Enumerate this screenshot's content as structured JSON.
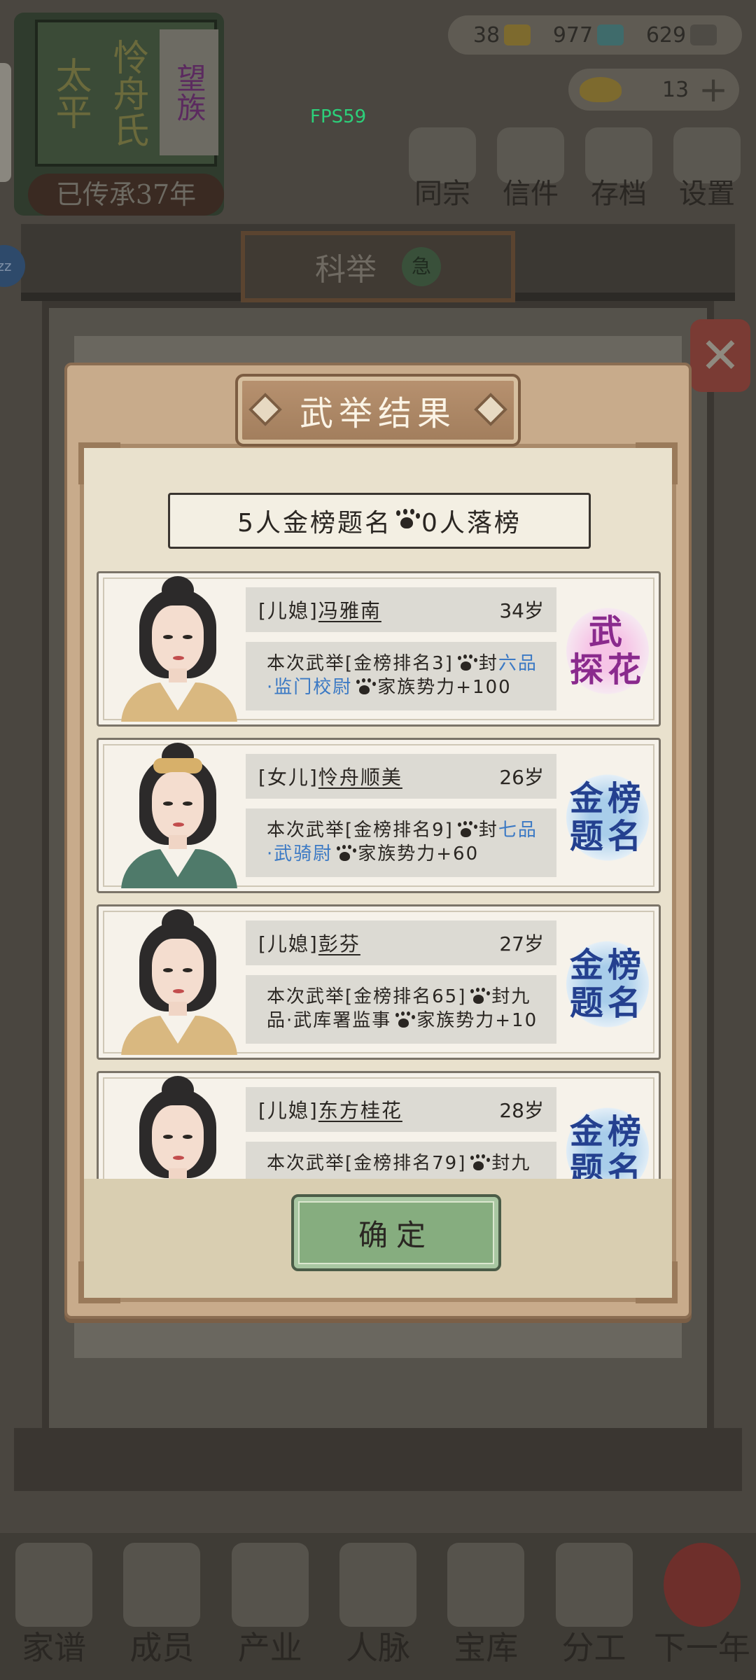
{
  "header": {
    "family_plaque": [
      "太平",
      "怜舟氏"
    ],
    "family_side": "望族",
    "inherit_text": "已传承37年",
    "fps": "FPS59",
    "currencies": [
      {
        "icon": "gold-coin-icon",
        "value": "38",
        "color": "#7d6a2e"
      },
      {
        "icon": "silver-bill-icon",
        "value": "977",
        "color": "#3f6b6b"
      },
      {
        "icon": "copper-coin-icon",
        "value": "629",
        "color": "#4e4b45"
      }
    ],
    "gold_ingot": "13",
    "top_menu": [
      "同宗",
      "信件",
      "存档",
      "设置"
    ]
  },
  "hall": {
    "title": "科举",
    "badge": "急",
    "zz_badge": "zz"
  },
  "bottom_nav": [
    "家谱",
    "成员",
    "产业",
    "人脉",
    "宝库",
    "分工",
    "下一年"
  ],
  "modal": {
    "title": "武举结果",
    "summary_pass": "5人金榜题名",
    "summary_fail": "0人落榜",
    "confirm_label": "确定",
    "results": [
      {
        "relation": "[儿媳]",
        "name": "冯雅南",
        "age": "34岁",
        "desc_pre": "本次武举[金榜排名3]",
        "desc_feng": "封",
        "rank_title": "六品·监门校尉",
        "rank_colored": true,
        "desc_power": "家族势力+100",
        "stamp": [
          "武",
          "探花"
        ],
        "stamp_type": "tanhua",
        "robe_color": "#d9b880"
      },
      {
        "relation": "[女儿]",
        "name": "怜舟顺美",
        "age": "26岁",
        "desc_pre": "本次武举[金榜排名9]",
        "desc_feng": "封",
        "rank_title": "七品·武骑尉",
        "rank_colored": true,
        "desc_power": "家族势力+60",
        "stamp": [
          "金榜",
          "题名"
        ],
        "stamp_type": "jinbang",
        "robe_color": "#4f7a6a"
      },
      {
        "relation": "[儿媳]",
        "name": "彭芬",
        "age": "27岁",
        "desc_pre": "本次武举[金榜排名65]",
        "desc_feng": "封",
        "rank_title": "九品·武库署监事",
        "rank_colored": false,
        "desc_power": "家族势力+10",
        "stamp": [
          "金榜",
          "题名"
        ],
        "stamp_type": "jinbang",
        "robe_color": "#d9b880"
      },
      {
        "relation": "[儿媳]",
        "name": "东方桂花",
        "age": "28岁",
        "desc_pre": "本次武举[金榜排名79]",
        "desc_feng": "封",
        "rank_title": "九",
        "rank_colored": false,
        "desc_power": "",
        "stamp": [
          "金榜",
          "题名"
        ],
        "stamp_type": "jinbang",
        "robe_color": "#d9b880"
      }
    ]
  }
}
